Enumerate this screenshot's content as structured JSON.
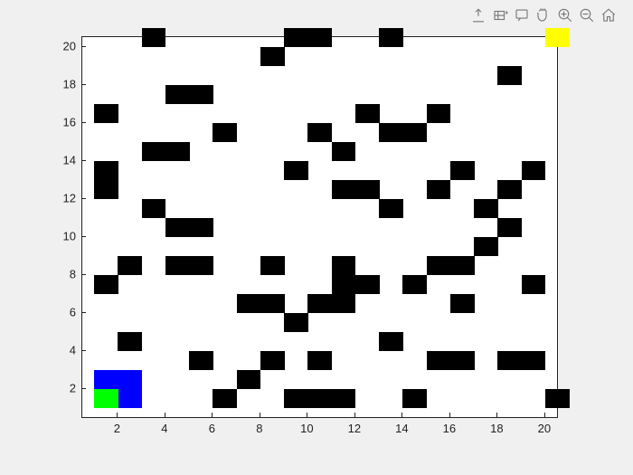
{
  "toolbar": {
    "icons": [
      {
        "name": "export-icon"
      },
      {
        "name": "brush-icon"
      },
      {
        "name": "datatip-icon"
      },
      {
        "name": "pan-icon"
      },
      {
        "name": "zoomin-icon"
      },
      {
        "name": "zoomout-icon"
      },
      {
        "name": "home-icon"
      }
    ]
  },
  "chart_data": {
    "type": "heatmap",
    "title": "",
    "xlabel": "",
    "ylabel": "",
    "xlim": [
      0.5,
      20.5
    ],
    "ylim": [
      0.5,
      20.5
    ],
    "xticks": [
      2,
      4,
      6,
      8,
      10,
      12,
      14,
      16,
      18,
      20
    ],
    "yticks": [
      2,
      4,
      6,
      8,
      10,
      12,
      14,
      16,
      18,
      20
    ],
    "colors": {
      "empty": "#ffffff",
      "wall": "#000000",
      "start": "#00ff00",
      "path": "#0000ff",
      "goal": "#ffff00"
    },
    "start": {
      "x": 1,
      "y": 1
    },
    "goal": {
      "x": 20,
      "y": 20
    },
    "path": [
      {
        "x": 1,
        "y": 2
      },
      {
        "x": 2,
        "y": 2
      },
      {
        "x": 2,
        "y": 1
      }
    ],
    "walls": [
      {
        "x": 6,
        "y": 1
      },
      {
        "x": 9,
        "y": 1
      },
      {
        "x": 10,
        "y": 1
      },
      {
        "x": 11,
        "y": 1
      },
      {
        "x": 14,
        "y": 1
      },
      {
        "x": 20,
        "y": 1
      },
      {
        "x": 7,
        "y": 2
      },
      {
        "x": 5,
        "y": 3
      },
      {
        "x": 8,
        "y": 3
      },
      {
        "x": 10,
        "y": 3
      },
      {
        "x": 15,
        "y": 3
      },
      {
        "x": 16,
        "y": 3
      },
      {
        "x": 18,
        "y": 3
      },
      {
        "x": 19,
        "y": 3
      },
      {
        "x": 2,
        "y": 4
      },
      {
        "x": 13,
        "y": 4
      },
      {
        "x": 9,
        "y": 5
      },
      {
        "x": 7,
        "y": 6
      },
      {
        "x": 8,
        "y": 6
      },
      {
        "x": 10,
        "y": 6
      },
      {
        "x": 11,
        "y": 6
      },
      {
        "x": 16,
        "y": 6
      },
      {
        "x": 1,
        "y": 7
      },
      {
        "x": 11,
        "y": 7
      },
      {
        "x": 12,
        "y": 7
      },
      {
        "x": 14,
        "y": 7
      },
      {
        "x": 19,
        "y": 7
      },
      {
        "x": 2,
        "y": 8
      },
      {
        "x": 4,
        "y": 8
      },
      {
        "x": 5,
        "y": 8
      },
      {
        "x": 8,
        "y": 8
      },
      {
        "x": 11,
        "y": 8
      },
      {
        "x": 15,
        "y": 8
      },
      {
        "x": 16,
        "y": 8
      },
      {
        "x": 17,
        "y": 9
      },
      {
        "x": 4,
        "y": 10
      },
      {
        "x": 5,
        "y": 10
      },
      {
        "x": 18,
        "y": 10
      },
      {
        "x": 3,
        "y": 11
      },
      {
        "x": 13,
        "y": 11
      },
      {
        "x": 17,
        "y": 11
      },
      {
        "x": 1,
        "y": 12
      },
      {
        "x": 11,
        "y": 12
      },
      {
        "x": 12,
        "y": 12
      },
      {
        "x": 15,
        "y": 12
      },
      {
        "x": 18,
        "y": 12
      },
      {
        "x": 1,
        "y": 13
      },
      {
        "x": 9,
        "y": 13
      },
      {
        "x": 16,
        "y": 13
      },
      {
        "x": 19,
        "y": 13
      },
      {
        "x": 3,
        "y": 14
      },
      {
        "x": 4,
        "y": 14
      },
      {
        "x": 11,
        "y": 14
      },
      {
        "x": 6,
        "y": 15
      },
      {
        "x": 10,
        "y": 15
      },
      {
        "x": 13,
        "y": 15
      },
      {
        "x": 14,
        "y": 15
      },
      {
        "x": 1,
        "y": 16
      },
      {
        "x": 12,
        "y": 16
      },
      {
        "x": 15,
        "y": 16
      },
      {
        "x": 4,
        "y": 17
      },
      {
        "x": 5,
        "y": 17
      },
      {
        "x": 18,
        "y": 18
      },
      {
        "x": 8,
        "y": 19
      },
      {
        "x": 3,
        "y": 20
      },
      {
        "x": 9,
        "y": 20
      },
      {
        "x": 10,
        "y": 20
      },
      {
        "x": 13,
        "y": 20
      }
    ]
  }
}
